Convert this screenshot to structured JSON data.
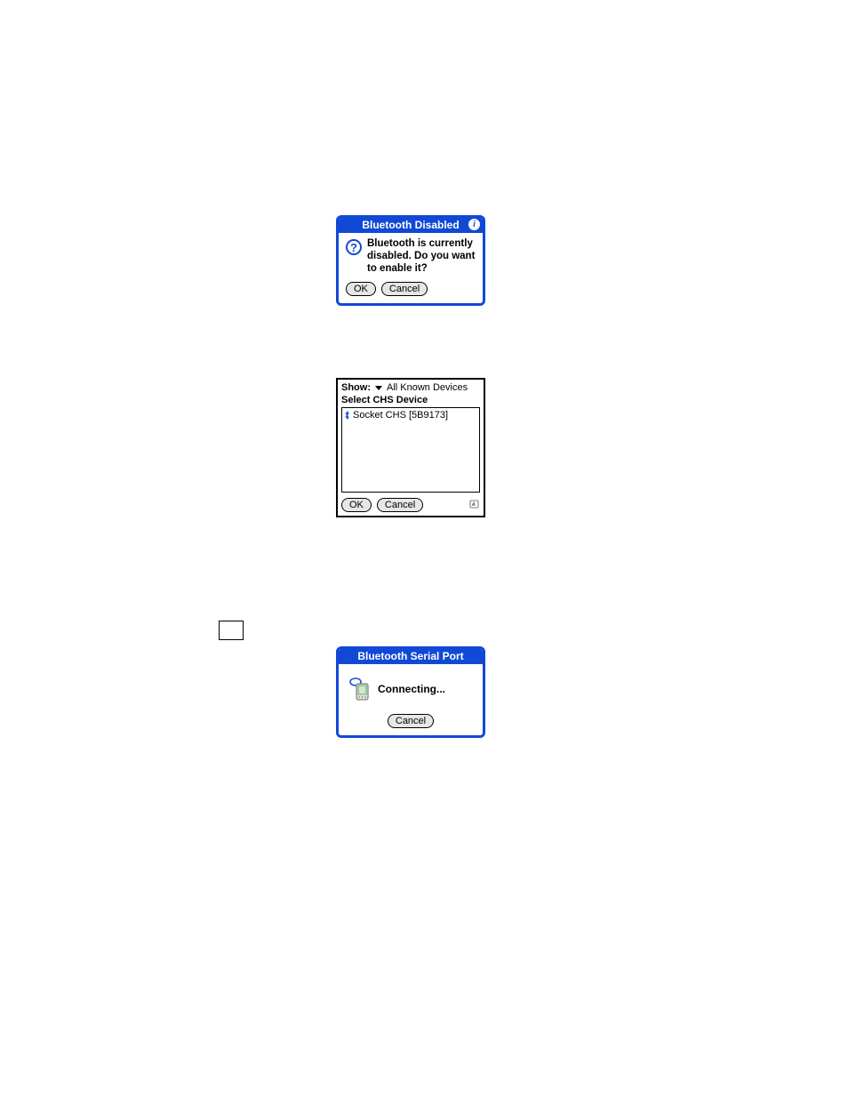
{
  "dialog1": {
    "title": "Bluetooth Disabled",
    "message": "Bluetooth is currently disabled.  Do you want to enable it?",
    "ok_label": "OK",
    "cancel_label": "Cancel"
  },
  "select_panel": {
    "show_label": "Show:",
    "show_value": "All Known Devices",
    "heading": "Select CHS Device",
    "devices": [
      {
        "name": "Socket CHS [5B9173]"
      }
    ],
    "ok_label": "OK",
    "cancel_label": "Cancel"
  },
  "dialog3": {
    "title": "Bluetooth Serial Port",
    "status": "Connecting...",
    "cancel_label": "Cancel"
  }
}
